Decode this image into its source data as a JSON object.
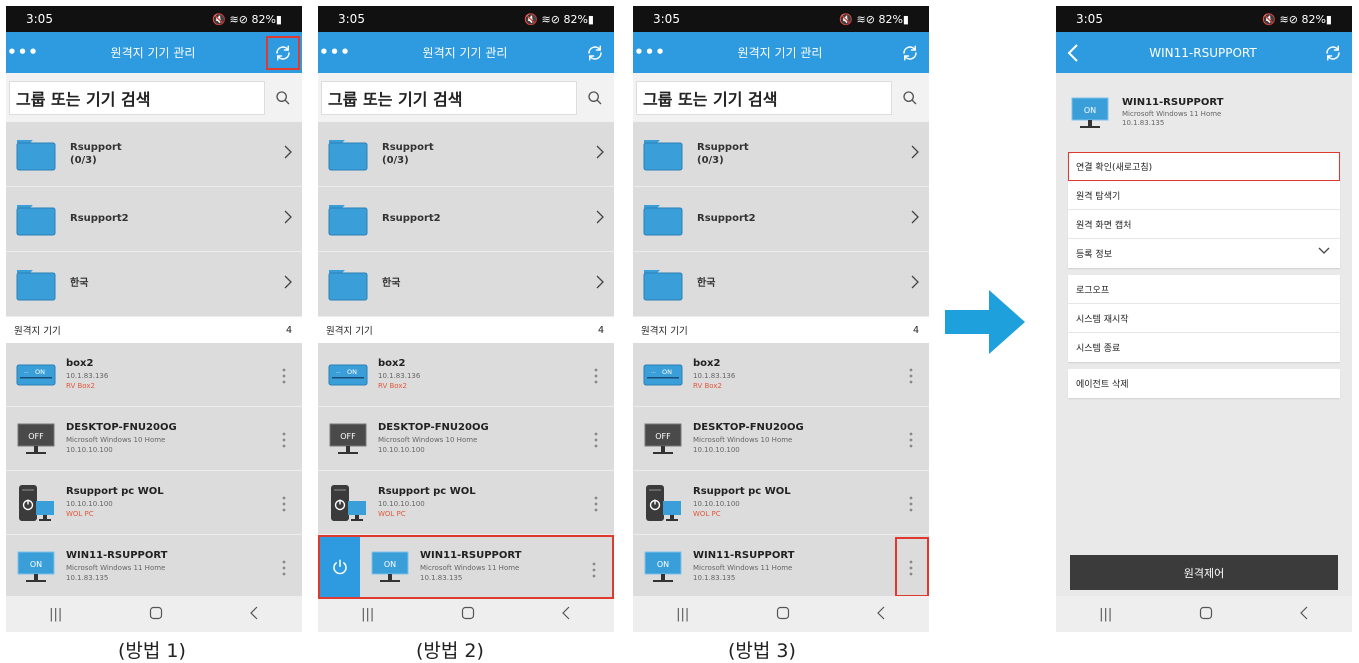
{
  "status": {
    "time": "3:05",
    "left_icons": "▣ ☗ ▲ •",
    "right": "🔇 ≋⊘ 82%▮"
  },
  "list_screen": {
    "title": "원격지 기기 관리",
    "menu": "•••",
    "search_placeholder": "그룹 또는 기기 검색",
    "folders": [
      {
        "name": "Rsupport",
        "count": "(0/3)"
      },
      {
        "name": "Rsupport2",
        "count": ""
      },
      {
        "name": "한국",
        "count": ""
      }
    ],
    "section": {
      "label": "원격지 기기",
      "count": "4"
    },
    "devices": [
      {
        "name": "box2",
        "line1": "10.1.83.136",
        "line2": "RV Box2",
        "icon": "rvbox-icon",
        "state": "ON"
      },
      {
        "name": "DESKTOP-FNU20OG",
        "line1": "Microsoft Windows 10 Home",
        "line2": "10.10.10.100",
        "icon": "monitor-off-icon",
        "state": "OFF"
      },
      {
        "name": "Rsupport pc WOL",
        "line1": "10.10.10.100",
        "line2": "WOL PC",
        "icon": "wol-pc-icon",
        "state": ""
      },
      {
        "name": "WIN11-RSUPPORT",
        "line1": "Microsoft Windows 11 Home",
        "line2": "10.1.83.135",
        "icon": "monitor-on-icon",
        "state": "ON"
      }
    ]
  },
  "detail_screen": {
    "title": "WIN11-RSUPPORT",
    "device": {
      "name": "WIN11-RSUPPORT",
      "os": "Microsoft Windows 11 Home",
      "ip": "10.1.83.135",
      "state": "ON"
    },
    "group1": [
      "연결 확인(새로고침)",
      "원격 탐색기",
      "원격 화면 캡처",
      "등록 정보"
    ],
    "group2": [
      "로그오프",
      "시스템 재시작",
      "시스템 종료"
    ],
    "group3": [
      "에이전트 삭제"
    ],
    "remote_button": "원격제어"
  },
  "captions": [
    "(방법 1)",
    "(방법 2)",
    "(방법 3)"
  ],
  "colors": {
    "appbar": "#2e9be0",
    "highlight": "#e0392f",
    "arrow": "#1ea0dc"
  }
}
